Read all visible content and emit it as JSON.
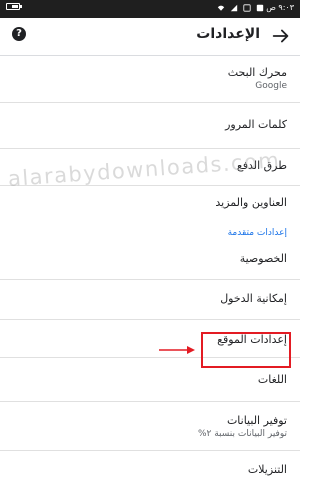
{
  "status_bar": {
    "time": "٩:٠٣ ص"
  },
  "app_bar": {
    "title": "الإعدادات",
    "back_icon": "arrow-forward-icon",
    "help_icon": "help-circle-icon",
    "help_glyph": "?"
  },
  "settings": {
    "search_engine": {
      "label": "محرك البحث",
      "value": "Google"
    },
    "passwords": {
      "label": "كلمات المرور"
    },
    "payment_methods": {
      "label": "طرق الدفع"
    },
    "addresses": {
      "label": "العناوين والمزيد"
    },
    "advanced_header": "إعدادات متقدمة",
    "privacy": {
      "label": "الخصوصية"
    },
    "accessibility": {
      "label": "إمكانية الدخول"
    },
    "site_settings": {
      "label": "إعدادات الموقع"
    },
    "languages": {
      "label": "اللغات"
    },
    "data_saver": {
      "label": "توفير البيانات",
      "value": "توفير البيانات بنسبة ٢%"
    },
    "downloads": {
      "label": "التنزيلات"
    }
  },
  "watermark": "alarabydownloads.com",
  "colors": {
    "accent": "#1a73e8",
    "highlight": "#e31b23",
    "text": "#202124",
    "secondary_text": "#5f6368"
  }
}
